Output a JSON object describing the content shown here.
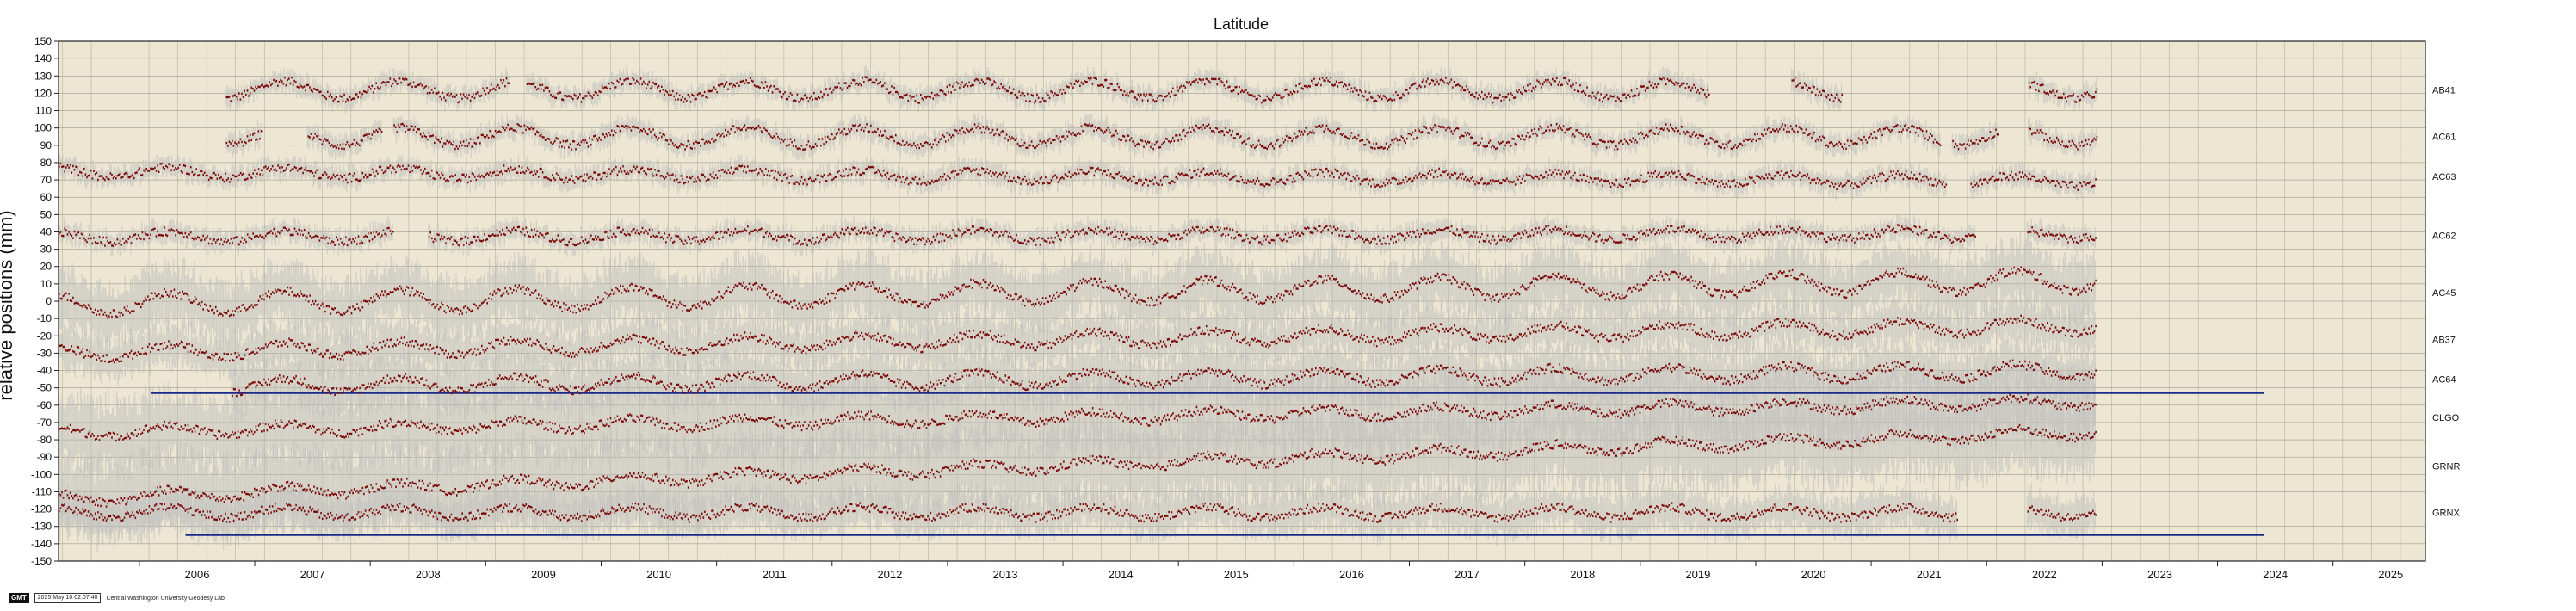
{
  "chart_data": {
    "type": "scatter",
    "title": "Latitude",
    "xlabel": "",
    "ylabel": "relative positions (mm)",
    "xlim": [
      2005.3,
      2025.8
    ],
    "ylim": [
      -150,
      150
    ],
    "x_ticks": [
      2006,
      2007,
      2008,
      2009,
      2010,
      2011,
      2012,
      2013,
      2014,
      2015,
      2016,
      2017,
      2018,
      2019,
      2020,
      2021,
      2022,
      2023,
      2024,
      2025
    ],
    "y_ticks": [
      150,
      140,
      130,
      120,
      110,
      100,
      90,
      80,
      70,
      60,
      50,
      40,
      30,
      20,
      10,
      0,
      -10,
      -20,
      -30,
      -40,
      -50,
      -60,
      -70,
      -80,
      -90,
      -100,
      -110,
      -120,
      -130,
      -140,
      -150
    ],
    "grid": true,
    "background": "#ece6d2",
    "point_color": "#7a0a0a",
    "error_color": "#bdbdbd",
    "reference_line_color": "#1a2a8a",
    "reference_lines": [
      {
        "y": -53,
        "x": [
          2006.1,
          2024.4
        ]
      },
      {
        "y": -135,
        "x": [
          2006.4,
          2024.4
        ]
      }
    ],
    "series": [
      {
        "name": "AB41",
        "offset": 122,
        "start": 2006.75,
        "end": 2022.95,
        "gaps": [
          [
            2009.2,
            2009.35
          ],
          [
            2019.6,
            2020.3
          ],
          [
            2020.75,
            2022.35
          ]
        ],
        "trend": 0,
        "error": 5,
        "waves": [
          [
            5,
            0.5
          ]
        ]
      },
      {
        "name": "AC61",
        "offset": 95,
        "start": 2006.75,
        "end": 2022.95,
        "gaps": [
          [
            2007.05,
            2007.45
          ],
          [
            2008.1,
            2008.2
          ],
          [
            2021.6,
            2021.7
          ],
          [
            2022.1,
            2022.35
          ]
        ],
        "trend": 0,
        "error": 5,
        "waves": [
          [
            5,
            0.5
          ]
        ]
      },
      {
        "name": "AC63",
        "offset": 72,
        "start": 2005.3,
        "end": 2022.95,
        "gaps": [
          [
            2021.65,
            2021.85
          ]
        ],
        "trend": -0.3,
        "error": 5,
        "waves": [
          [
            3,
            0.5
          ]
        ]
      },
      {
        "name": "AC62",
        "offset": 38,
        "start": 2005.3,
        "end": 2022.95,
        "gaps": [
          [
            2008.2,
            2008.5
          ],
          [
            2021.9,
            2022.35
          ]
        ],
        "trend": 0.1,
        "error": 5,
        "waves": [
          [
            3,
            0.5
          ]
        ]
      },
      {
        "name": "AC45",
        "offset": 5,
        "start": 2005.3,
        "end": 2022.95,
        "gaps": [],
        "trend": 0.8,
        "error": 15,
        "waves": [
          [
            6,
            0.5
          ]
        ]
      },
      {
        "name": "AB37",
        "offset": -22,
        "start": 2005.3,
        "end": 2022.95,
        "gaps": [],
        "trend": 0.9,
        "error": 10,
        "waves": [
          [
            4,
            0.5
          ]
        ]
      },
      {
        "name": "AC64",
        "offset": -45,
        "start": 2006.8,
        "end": 2022.95,
        "gaps": [],
        "trend": 0.55,
        "error": 12,
        "waves": [
          [
            4,
            0.5
          ]
        ]
      },
      {
        "name": "CLGO",
        "offset": -67,
        "start": 2005.3,
        "end": 2022.95,
        "gaps": [],
        "trend": 1.0,
        "error": 18,
        "waves": [
          [
            3,
            0.5
          ]
        ]
      },
      {
        "name": "GRNR",
        "offset": -95,
        "start": 2005.3,
        "end": 2022.95,
        "gaps": [],
        "trend": 2.2,
        "error": 20,
        "waves": [
          [
            3,
            0.5
          ]
        ]
      },
      {
        "name": "GRNX",
        "offset": -122,
        "start": 2005.3,
        "end": 2022.95,
        "gaps": [
          [
            2021.75,
            2022.35
          ]
        ],
        "trend": 0,
        "error": 10,
        "waves": [
          [
            3,
            0.5
          ]
        ]
      }
    ]
  },
  "footer": {
    "logo": "GMT",
    "timestamp": "2025 May 10 02:07:40",
    "lab": "Central Washington University Geodesy Lab"
  }
}
